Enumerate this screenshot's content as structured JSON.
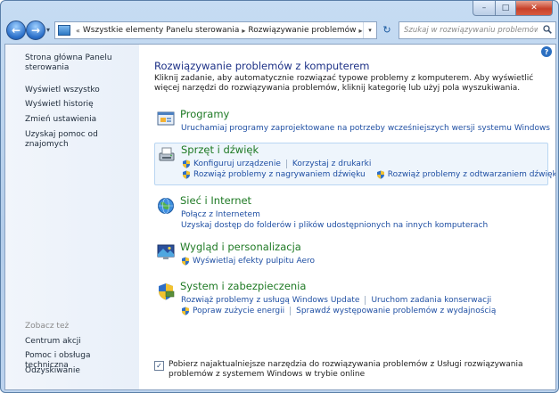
{
  "window": {
    "minimize_glyph": "–",
    "maximize_glyph": "□",
    "close_glyph": "✕"
  },
  "navbar": {
    "back_glyph": "←",
    "forward_glyph": "→",
    "history_glyph": "▾",
    "address_overflow": "«",
    "crumbs": [
      "Wszystkie elementy Panelu sterowania",
      "Rozwiązywanie problemów"
    ],
    "crumb_separator": "▸",
    "dropdown_glyph": "▾",
    "refresh_glyph": "↻",
    "search_placeholder": "Szukaj w rozwiązywaniu problemów"
  },
  "sidebar": {
    "items": [
      "Strona główna Panelu sterowania",
      "Wyświetl wszystko",
      "Wyświetl historię",
      "Zmień ustawienia",
      "Uzyskaj pomoc od znajomych"
    ],
    "see_also_heading": "Zobacz też",
    "see_also": [
      "Centrum akcji",
      "Pomoc i obsługa techniczna",
      "Odzyskiwanie"
    ]
  },
  "main": {
    "help_glyph": "?",
    "title": "Rozwiązywanie problemów z komputerem",
    "intro": "Kliknij zadanie, aby automatycznie rozwiązać typowe problemy z komputerem. Aby wyświetlić więcej narzędzi do rozwiązywania problemów, kliknij kategorię lub użyj pola wyszukiwania.",
    "categories": [
      {
        "title": "Programy",
        "links": [
          "Uruchamiaj programy zaprojektowane na potrzeby wcześniejszych wersji systemu Windows"
        ]
      },
      {
        "title": "Sprzęt i dźwięk",
        "links": [
          "Konfiguruj urządzenie",
          "Korzystaj z drukarki",
          "Rozwiąż problemy z nagrywaniem dźwięku",
          "Rozwiąż problemy z odtwarzaniem dźwięku"
        ]
      },
      {
        "title": "Sieć i Internet",
        "links": [
          "Połącz z Internetem",
          "Uzyskaj dostęp do folderów i plików udostępnionych na innych komputerach"
        ]
      },
      {
        "title": "Wygląd i personalizacja",
        "links": [
          "Wyświetlaj efekty pulpitu Aero"
        ]
      },
      {
        "title": "System i zabezpieczenia",
        "links": [
          "Rozwiąż problemy z usługą Windows Update",
          "Uruchom zadania konserwacji",
          "Popraw zużycie energii",
          "Sprawdź występowanie problemów z wydajnością"
        ]
      }
    ],
    "online_option": {
      "checked": true,
      "check_glyph": "✓",
      "label": "Pobierz najaktualniejsze narzędzia do rozwiązywania problemów z Usługi rozwiązywania problemów z systemem Windows w trybie online"
    }
  }
}
